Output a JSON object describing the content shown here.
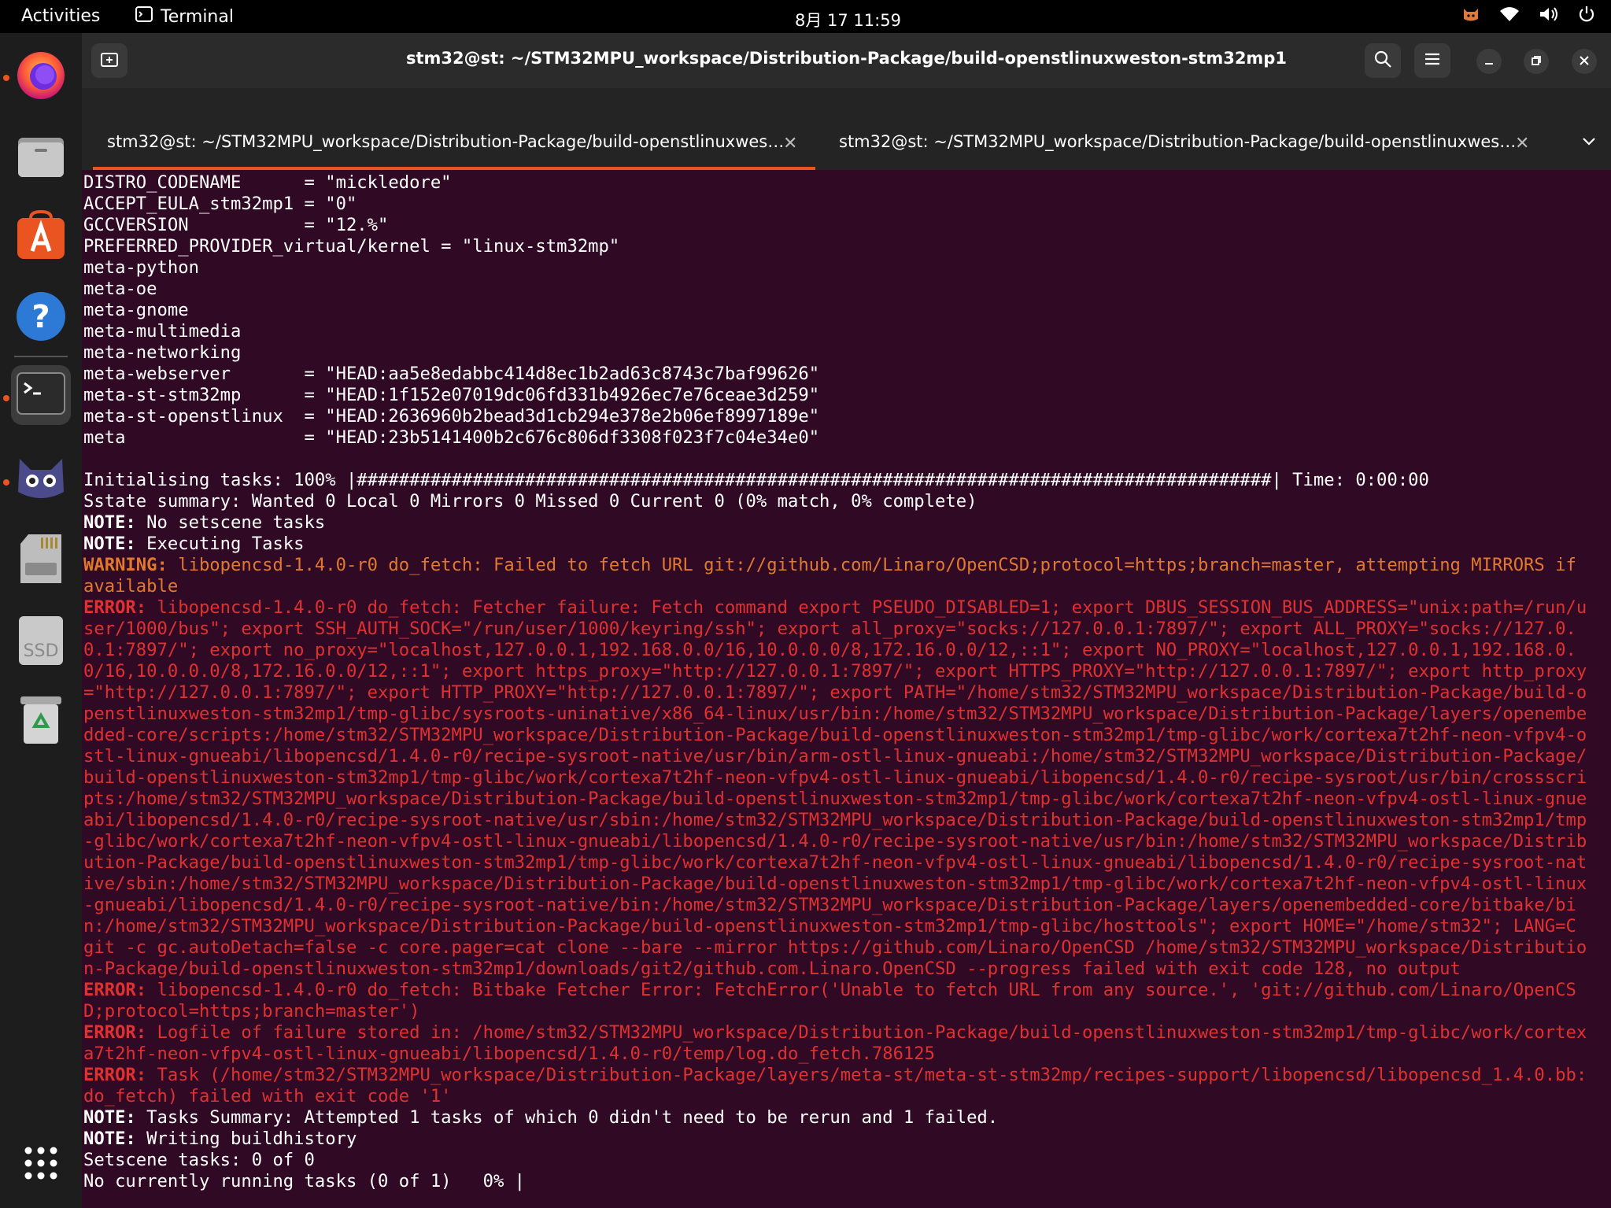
{
  "topbar": {
    "activities": "Activities",
    "app_name": "Terminal",
    "clock": "8月 17  11:59"
  },
  "dock": {
    "items": [
      {
        "name": "Firefox",
        "icon": "firefox-icon"
      },
      {
        "name": "Files",
        "icon": "files-icon"
      },
      {
        "name": "App Center",
        "icon": "app-center-icon"
      },
      {
        "name": "Help",
        "icon": "help-icon"
      },
      {
        "name": "Terminal",
        "icon": "terminal-icon"
      },
      {
        "name": "Cat app",
        "icon": "cat-icon"
      },
      {
        "name": "SD card",
        "icon": "sd-card-icon"
      },
      {
        "name": "SSD",
        "icon": "ssd-icon",
        "label": "SSD"
      },
      {
        "name": "Trash",
        "icon": "trash-icon"
      },
      {
        "name": "Show Apps",
        "icon": "app-grid-icon"
      }
    ]
  },
  "window": {
    "title": "stm32@st: ~/STM32MPU_workspace/Distribution-Package/build-openstlinuxweston-stm32mp1",
    "tabs": [
      {
        "label": "stm32@st: ~/STM32MPU_workspace/Distribution-Package/build-openstlinuxwes…",
        "active": true
      },
      {
        "label": "stm32@st: ~/STM32MPU_workspace/Distribution-Package/build-openstlinuxwes…",
        "active": false
      }
    ]
  },
  "terminal": {
    "lines": {
      "l1": "DISTRO_CODENAME      = \"mickledore\"",
      "l2": "ACCEPT_EULA_stm32mp1 = \"0\"",
      "l3": "GCCVERSION           = \"12.%\"",
      "l4": "PREFERRED_PROVIDER_virtual/kernel = \"linux-stm32mp\"",
      "l5": "meta-python",
      "l6": "meta-oe",
      "l7": "meta-gnome",
      "l8": "meta-multimedia",
      "l9": "meta-networking",
      "l10": "meta-webserver       = \"HEAD:aa5e8edabbc414d8ec1b2ad63c8743c7baf99626\"",
      "l11": "meta-st-stm32mp      = \"HEAD:1f152e07019dc06fd331b4926ec7e76ceae3d259\"",
      "l12": "meta-st-openstlinux  = \"HEAD:2636960b2bead3d1cb294e378e2b06ef8997189e\"",
      "l13": "meta                 = \"HEAD:23b5141400b2c676c806df3308f023f7c04e34e0\"",
      "l14": "Initialising tasks: 100% |#######################################################################################| Time: 0:00:00",
      "l15": "Sstate summary: Wanted 0 Local 0 Mirrors 0 Missed 0 Current 0 (0% match, 0% complete)"
    },
    "labels": {
      "note": "NOTE:",
      "warning": "WARNING:",
      "error": "ERROR:"
    },
    "note1": " No setscene tasks",
    "note2": " Executing Tasks",
    "warning1": " libopencsd-1.4.0-r0 do_fetch: Failed to fetch URL git://github.com/Linaro/OpenCSD;protocol=https;branch=master, attempting MIRRORS if available",
    "error1": " libopencsd-1.4.0-r0 do_fetch: Fetcher failure: Fetch command export PSEUDO_DISABLED=1; export DBUS_SESSION_BUS_ADDRESS=\"unix:path=/run/user/1000/bus\"; export SSH_AUTH_SOCK=\"/run/user/1000/keyring/ssh\"; export all_proxy=\"socks://127.0.0.1:7897/\"; export ALL_PROXY=\"socks://127.0.0.1:7897/\"; export no_proxy=\"localhost,127.0.0.1,192.168.0.0/16,10.0.0.0/8,172.16.0.0/12,::1\"; export NO_PROXY=\"localhost,127.0.0.1,192.168.0.0/16,10.0.0.0/8,172.16.0.0/12,::1\"; export https_proxy=\"http://127.0.0.1:7897/\"; export HTTPS_PROXY=\"http://127.0.0.1:7897/\"; export http_proxy=\"http://127.0.0.1:7897/\"; export HTTP_PROXY=\"http://127.0.0.1:7897/\"; export PATH=\"/home/stm32/STM32MPU_workspace/Distribution-Package/build-openstlinuxweston-stm32mp1/tmp-glibc/sysroots-uninative/x86_64-linux/usr/bin:/home/stm32/STM32MPU_workspace/Distribution-Package/layers/openembedded-core/scripts:/home/stm32/STM32MPU_workspace/Distribution-Package/build-openstlinuxweston-stm32mp1/tmp-glibc/work/cortexa7t2hf-neon-vfpv4-ostl-linux-gnueabi/libopencsd/1.4.0-r0/recipe-sysroot-native/usr/bin/arm-ostl-linux-gnueabi:/home/stm32/STM32MPU_workspace/Distribution-Package/build-openstlinuxweston-stm32mp1/tmp-glibc/work/cortexa7t2hf-neon-vfpv4-ostl-linux-gnueabi/libopencsd/1.4.0-r0/recipe-sysroot/usr/bin/crossscripts:/home/stm32/STM32MPU_workspace/Distribution-Package/build-openstlinuxweston-stm32mp1/tmp-glibc/work/cortexa7t2hf-neon-vfpv4-ostl-linux-gnueabi/libopencsd/1.4.0-r0/recipe-sysroot-native/usr/sbin:/home/stm32/STM32MPU_workspace/Distribution-Package/build-openstlinuxweston-stm32mp1/tmp-glibc/work/cortexa7t2hf-neon-vfpv4-ostl-linux-gnueabi/libopencsd/1.4.0-r0/recipe-sysroot-native/usr/bin:/home/stm32/STM32MPU_workspace/Distribution-Package/build-openstlinuxweston-stm32mp1/tmp-glibc/work/cortexa7t2hf-neon-vfpv4-ostl-linux-gnueabi/libopencsd/1.4.0-r0/recipe-sysroot-native/sbin:/home/stm32/STM32MPU_workspace/Distribution-Package/build-openstlinuxweston-stm32mp1/tmp-glibc/work/cortexa7t2hf-neon-vfpv4-ostl-linux-gnueabi/libopencsd/1.4.0-r0/recipe-sysroot-native/bin:/home/stm32/STM32MPU_workspace/Distribution-Package/layers/openembedded-core/bitbake/bin:/home/stm32/STM32MPU_workspace/Distribution-Package/build-openstlinuxweston-stm32mp1/tmp-glibc/hosttools\"; export HOME=\"/home/stm32\"; LANG=C git -c gc.autoDetach=false -c core.pager=cat clone --bare --mirror https://github.com/Linaro/OpenCSD /home/stm32/STM32MPU_workspace/Distribution-Package/build-openstlinuxweston-stm32mp1/downloads/git2/github.com.Linaro.OpenCSD --progress failed with exit code 128, no output",
    "error2": " libopencsd-1.4.0-r0 do_fetch: Bitbake Fetcher Error: FetchError('Unable to fetch URL from any source.', 'git://github.com/Linaro/OpenCSD;protocol=https;branch=master')",
    "error3": " Logfile of failure stored in: /home/stm32/STM32MPU_workspace/Distribution-Package/build-openstlinuxweston-stm32mp1/tmp-glibc/work/cortexa7t2hf-neon-vfpv4-ostl-linux-gnueabi/libopencsd/1.4.0-r0/temp/log.do_fetch.786125",
    "error4": " Task (/home/stm32/STM32MPU_workspace/Distribution-Package/layers/meta-st/meta-st-stm32mp/recipes-support/libopencsd/libopencsd_1.4.0.bb:do_fetch) failed with exit code '1'",
    "note3": " Tasks Summary: Attempted 1 tasks of which 0 didn't need to be rerun and 1 failed.",
    "note4": " Writing buildhistory",
    "l16": "Setscene tasks: 0 of 0",
    "l17": "No currently running tasks (0 of 1)   0% |"
  },
  "colors": {
    "terminal_bg": "#300a24",
    "error": "#e03131",
    "warning": "#e0792f",
    "accent": "#e95420"
  }
}
